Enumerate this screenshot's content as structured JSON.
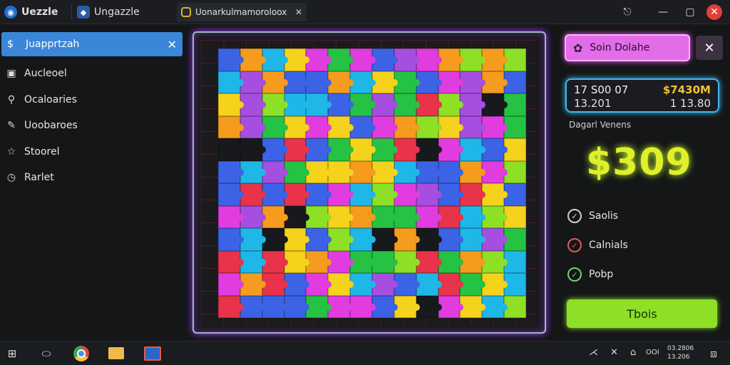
{
  "titlebar": {
    "tab1_title": "Uezzle",
    "tab2_title": "Ungazzle",
    "tab3_title": "Uonarkulmamoroloox",
    "tab3_close": "✕",
    "controls": [
      "⎋",
      "—",
      "▢",
      "✕"
    ]
  },
  "sidebar": {
    "active": {
      "icon": "$",
      "label": "Juapprtzah",
      "close": "✕"
    },
    "items": [
      {
        "icon": "image-icon",
        "label": "Aucleoel"
      },
      {
        "icon": "search-icon",
        "label": "Ocaloaries"
      },
      {
        "icon": "brush-icon",
        "label": "Uoobaroes"
      },
      {
        "icon": "star-icon",
        "label": "Stoorel"
      },
      {
        "icon": "clock-icon",
        "label": "Rarlet"
      }
    ]
  },
  "board": {
    "cols": 14,
    "rows": 12,
    "palette": [
      "#f5d21c",
      "#f59b1e",
      "#26c244",
      "#1fb7e8",
      "#3c63e6",
      "#e03ce0",
      "#a64ee0",
      "#e8334a",
      "#8de026",
      "#17191c"
    ]
  },
  "panel": {
    "solve_label": "Soin Dolahe",
    "solve_icon": "puzzle-icon",
    "close": "✕",
    "score": {
      "top_left": "17 S00 07",
      "top_right": "$7430M",
      "bottom_left": "13.201",
      "bottom_right": "1 13.80"
    },
    "small_label": "Dagarl Venens",
    "big_value": "$309",
    "options": [
      {
        "label": "Saolis",
        "style": "white",
        "mark": "✓"
      },
      {
        "label": "Calnials",
        "style": "red",
        "mark": "✓"
      },
      {
        "label": "Pobp",
        "style": "green",
        "mark": "✓"
      }
    ],
    "play_label": "Tbois"
  },
  "taskbar": {
    "tray": [
      "⋌",
      "✕",
      "⌂",
      "OOI"
    ],
    "clock_line1": "03.2806",
    "clock_line2": "13.206"
  }
}
